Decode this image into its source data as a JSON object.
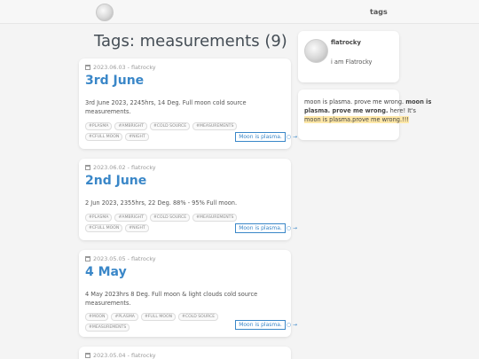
{
  "nav": {
    "tags_label": "tags"
  },
  "page": {
    "title": "Tags: measurements (9)"
  },
  "posts": [
    {
      "date": "2023.06.03",
      "author": "flatrocky",
      "title": "3rd June",
      "excerpt": "3rd June 2023, 2245hrs, 14 Deg. Full moon cold source measurements.",
      "tags": [
        "#PLASMA",
        "#AMBRIGHT",
        "#COLD SOURCE",
        "#MEASUREMENTS",
        "#CFULL MOON",
        "#NIGHT"
      ],
      "more_label": "Moon is plasma."
    },
    {
      "date": "2023.06.02",
      "author": "flatrocky",
      "title": "2nd June",
      "excerpt": "2 Jun 2023, 2355hrs, 22 Deg. 88% - 95% Full moon.",
      "tags": [
        "#PLASMA",
        "#AMBRIGHT",
        "#COLD SOURCE",
        "#MEASUREMENTS",
        "#CFULL MOON",
        "#NIGHT"
      ],
      "more_label": "Moon is plasma."
    },
    {
      "date": "2023.05.05",
      "author": "flatrocky",
      "title": "4 May",
      "excerpt": "4 May 2023hrs 8 Deg. Full moon & light clouds cold source measurements.",
      "tags": [
        "#MOON",
        "#PLASMA",
        "#FULL MOON",
        "#COLD SOURCE",
        "#MEASUREMENTS"
      ],
      "more_label": "Moon is plasma."
    },
    {
      "date": "2023.05.04",
      "author": "flatrocky"
    }
  ],
  "sidebar": {
    "author_name": "flatrocky",
    "author_bio": "i am Flatrocky",
    "about": {
      "line1": "moon is plasma. prove me wrong.",
      "bold": "moon is plasma. prove me wrong.",
      "here": "here! It's",
      "highlight": "moon is plasma.prove me wrong.!!!"
    }
  }
}
